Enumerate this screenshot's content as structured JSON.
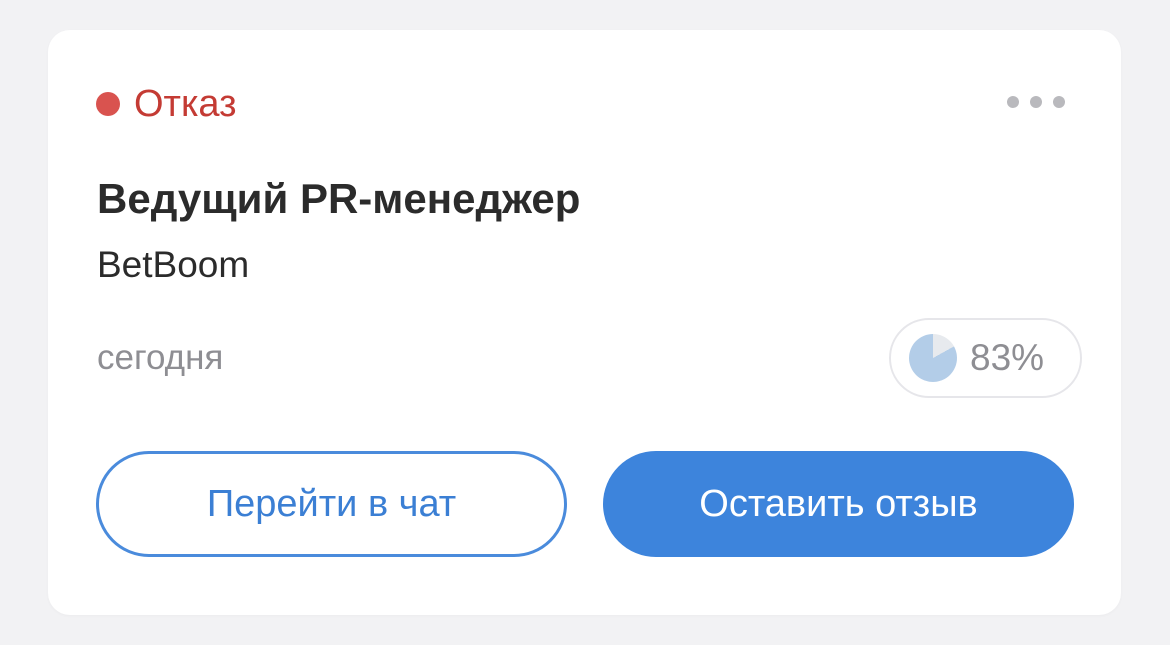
{
  "application": {
    "status": {
      "label": "Отказ",
      "color": "#d9534f"
    },
    "more_icon": "more-horizontal-icon",
    "job_title": "Ведущий PR-менеджер",
    "company": "BetBoom",
    "date": "сегодня",
    "match": {
      "value_text": "83%",
      "fraction": 0.83,
      "icon": "pie-progress-icon",
      "fill_color": "#b3cde8",
      "empty_color": "#e7eaee"
    }
  },
  "actions": {
    "chat_label": "Перейти в чат",
    "review_label": "Оставить отзыв",
    "accent_color": "#3d84dc"
  }
}
